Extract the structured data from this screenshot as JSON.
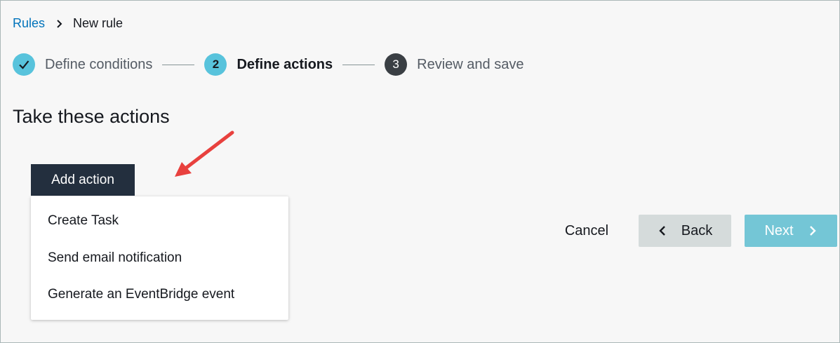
{
  "breadcrumb": {
    "root": "Rules",
    "current": "New rule"
  },
  "steps": [
    {
      "number": "1",
      "label": "Define conditions",
      "state": "complete"
    },
    {
      "number": "2",
      "label": "Define actions",
      "state": "active"
    },
    {
      "number": "3",
      "label": "Review and save",
      "state": "upcoming"
    }
  ],
  "section": {
    "title": "Take these actions"
  },
  "add_action": {
    "label": "Add action",
    "menu": [
      "Create Task",
      "Send email notification",
      "Generate an EventBridge event"
    ]
  },
  "footer": {
    "cancel_label": "Cancel",
    "back_label": "Back",
    "next_label": "Next"
  },
  "colors": {
    "link": "#0073bb",
    "step_active": "#58c3dc",
    "step_future": "#3a3f44",
    "primary_dark": "#232f3e",
    "next_disabled": "#74c6d6",
    "back_bg": "#d5dbdb",
    "arrow": "#e8413e"
  },
  "icons": {
    "breadcrumb_separator": "chevron-right-icon",
    "step_complete": "checkmark-icon",
    "back": "chevron-left-icon",
    "next": "chevron-right-icon",
    "annotation": "red-arrow-icon"
  }
}
